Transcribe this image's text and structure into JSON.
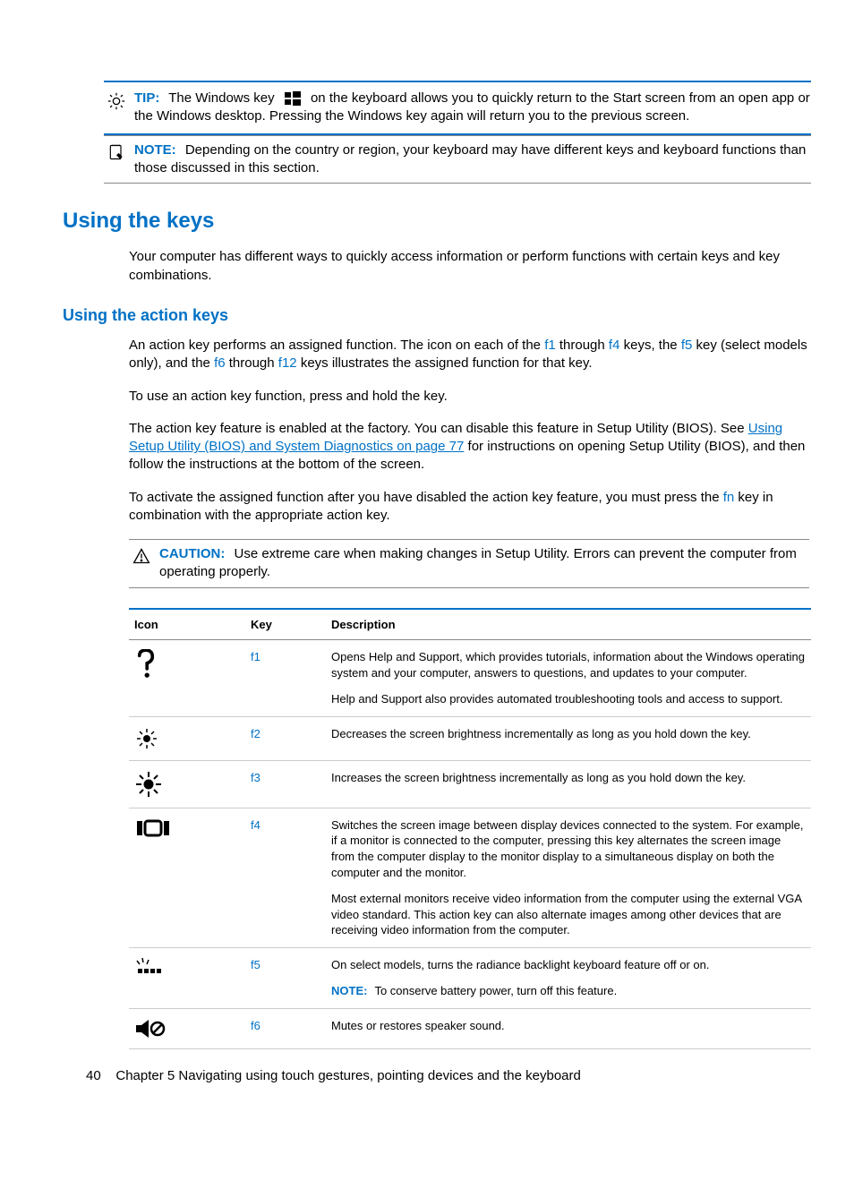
{
  "callouts": {
    "tip": {
      "label": "TIP:",
      "text_a": "The Windows key",
      "text_b": "on the keyboard allows you to quickly return to the Start screen from an open app or the Windows desktop. Pressing the Windows key again will return you to the previous screen."
    },
    "note": {
      "label": "NOTE:",
      "text": "Depending on the country or region, your keyboard may have different keys and keyboard functions than those discussed in this section."
    },
    "caution": {
      "label": "CAUTION:",
      "text": "Use extreme care when making changes in Setup Utility. Errors can prevent the computer from operating properly."
    }
  },
  "headings": {
    "h2": "Using the keys",
    "h3": "Using the action keys"
  },
  "paragraphs": {
    "intro": "Your computer has different ways to quickly access information or perform functions with certain keys and key combinations.",
    "action1_a": "An action key performs an assigned function. The icon on each of the ",
    "action1_b": " through ",
    "action1_c": " keys, the ",
    "action1_d": " key (select models only), and the ",
    "action1_e": " through ",
    "action1_f": " keys illustrates the assigned function for that key.",
    "f1": "f1",
    "f4": "f4",
    "f5": "f5",
    "f6": "f6",
    "f12": "f12",
    "action2": "To use an action key function, press and hold the key.",
    "action3_a": "The action key feature is enabled at the factory. You can disable this feature in Setup Utility (BIOS). See ",
    "action3_link": "Using Setup Utility (BIOS) and System Diagnostics on page 77",
    "action3_b": " for instructions on opening Setup Utility (BIOS), and then follow the instructions at the bottom of the screen.",
    "action4_a": "To activate the assigned function after you have disabled the action key feature, you must press the ",
    "fn": "fn",
    "action4_b": " key in combination with the appropriate action key."
  },
  "table": {
    "headers": {
      "icon": "Icon",
      "key": "Key",
      "desc": "Description"
    },
    "rows": [
      {
        "icon": "help-icon",
        "key": "f1",
        "desc": [
          "Opens Help and Support, which provides tutorials, information about the Windows operating system and your computer, answers to questions, and updates to your computer.",
          "Help and Support also provides automated troubleshooting tools and access to support."
        ]
      },
      {
        "icon": "brightness-down-icon",
        "key": "f2",
        "desc": [
          "Decreases the screen brightness incrementally as long as you hold down the key."
        ]
      },
      {
        "icon": "brightness-up-icon",
        "key": "f3",
        "desc": [
          "Increases the screen brightness incrementally as long as you hold down the key."
        ]
      },
      {
        "icon": "switch-display-icon",
        "key": "f4",
        "desc": [
          "Switches the screen image between display devices connected to the system. For example, if a monitor is connected to the computer, pressing this key alternates the screen image from the computer display to the monitor display to a simultaneous display on both the computer and the monitor.",
          "Most external monitors receive video information from the computer using the external VGA video standard. This action key can also alternate images among other devices that are receiving video information from the computer."
        ]
      },
      {
        "icon": "backlight-keyboard-icon",
        "key": "f5",
        "desc": [
          "On select models, turns the radiance backlight keyboard feature off or on."
        ],
        "note": {
          "label": "NOTE:",
          "text": "To conserve battery power, turn off this feature."
        }
      },
      {
        "icon": "mute-icon",
        "key": "f6",
        "desc": [
          "Mutes or restores speaker sound."
        ]
      }
    ]
  },
  "footer": {
    "page": "40",
    "chapter": "Chapter 5   Navigating using touch gestures, pointing devices and the keyboard"
  }
}
